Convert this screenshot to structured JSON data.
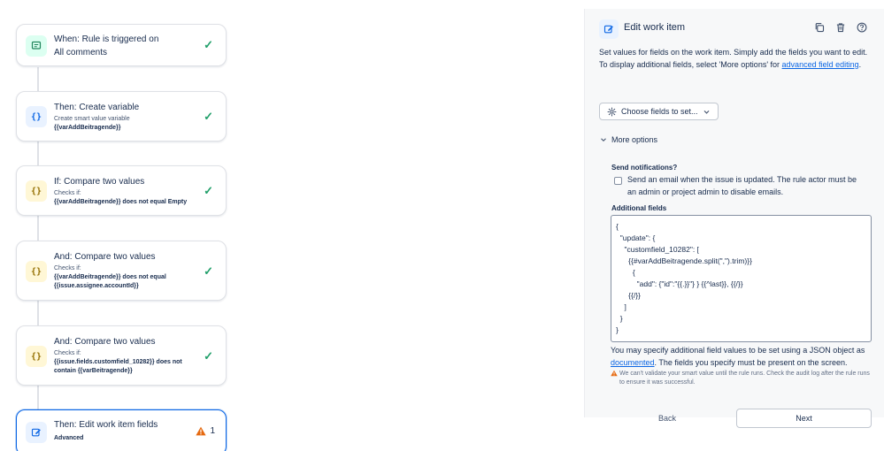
{
  "flow": {
    "cards": [
      {
        "title": "When: Rule is triggered on",
        "title2": "All comments"
      },
      {
        "title": "Then: Create variable",
        "sub1": "Create smart value variable",
        "sub2": "{{varAddBeitragende}}"
      },
      {
        "title": "If: Compare two values",
        "sub1": "Checks if:",
        "sub2": "{{varAddBeitragende}} does not equal Empty"
      },
      {
        "title": "And: Compare two values",
        "sub1": "Checks if:",
        "sub2": "{{varAddBeitragende}} does not equal",
        "sub3": "{{issue.assignee.accountId}}"
      },
      {
        "title": "And: Compare two values",
        "sub1": "Checks if:",
        "sub2": "{{issue.fields.customfield_10282}} does not",
        "sub3": "contain {{varBeitragende}}"
      },
      {
        "title": "Then: Edit work item fields",
        "sub1": "Advanced",
        "warning_count": "1"
      }
    ],
    "check_glyph": "✓"
  },
  "panel": {
    "title": "Edit work item",
    "desc_line1": "Set values for fields on the work item. Simply add the fields you want to edit.",
    "desc_line2_prefix": "To display additional fields, select 'More options' for ",
    "desc_link": "advanced field editing",
    "desc_line2_suffix": ".",
    "choose_fields_label": "Choose fields to set...",
    "more_options_label": "More options",
    "notifications_label": "Send notifications?",
    "notifications_text": "Send an email when the issue is updated. The rule actor must be an admin or project admin to disable emails.",
    "notifications_checked": false,
    "additional_fields_label": "Additional fields",
    "json_lines": [
      "{",
      "  \"update\": {",
      "    \"customfield_10282\": [",
      "      {{#varAddBeitragende.split(\",\").trim)}}",
      "        {",
      "          \"add\": {\"id\":\"{{.}}\"} } {{^last}}, {{/}}",
      "      {{/}}",
      "    ]",
      "  }",
      "}"
    ],
    "help_prefix": "You may specify additional field values to be set using a JSON object as ",
    "help_link": "documented",
    "help_suffix": ". The fields you specify must be present on the screen.",
    "warning_note": "We can't validate your smart value until the rule runs. Check the audit log after the rule runs to ensure it was successful.",
    "back_label": "Back",
    "next_label": "Next"
  },
  "colors": {
    "accent": "#0c66e4",
    "success": "#22a06b",
    "warning": "#e56910"
  },
  "icons": {
    "comment": "comment-icon",
    "variable": "braces-icon",
    "edit": "edit-icon",
    "clone": "copy-icon",
    "delete": "trash-icon",
    "help": "help-icon",
    "settings": "gear-icon",
    "chevron": "chevron-down-icon",
    "warning": "warning-icon"
  }
}
